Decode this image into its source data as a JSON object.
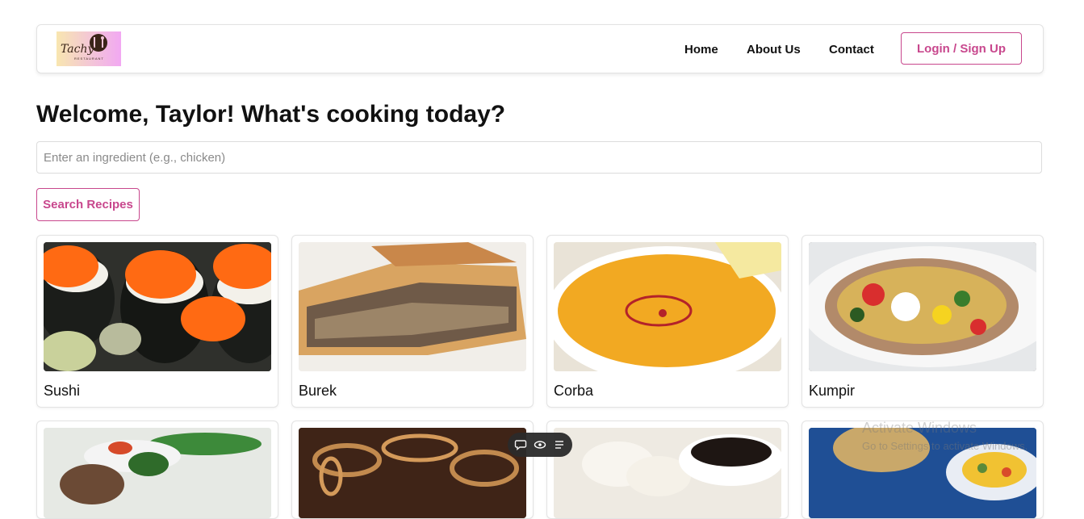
{
  "brand": {
    "logo_text": "Tachy",
    "logo_sub": "RESTAURANT"
  },
  "nav": {
    "home": "Home",
    "about": "About Us",
    "contact": "Contact",
    "login": "Login / Sign Up"
  },
  "main": {
    "welcome": "Welcome, Taylor! What's cooking today?",
    "search_placeholder": "Enter an ingredient (e.g., chicken)",
    "search_button": "Search Recipes"
  },
  "recipes": [
    {
      "title": "Sushi"
    },
    {
      "title": "Burek"
    },
    {
      "title": "Corba"
    },
    {
      "title": "Kumpir"
    }
  ],
  "toolbar": {
    "icons": [
      "comment-icon",
      "eye-icon",
      "list-icon"
    ]
  },
  "watermark": {
    "title": "Activate Windows",
    "subtitle": "Go to Settings to activate Windows."
  },
  "colors": {
    "accent": "#c8478d",
    "text": "#111111",
    "border": "#e2e2e2"
  }
}
